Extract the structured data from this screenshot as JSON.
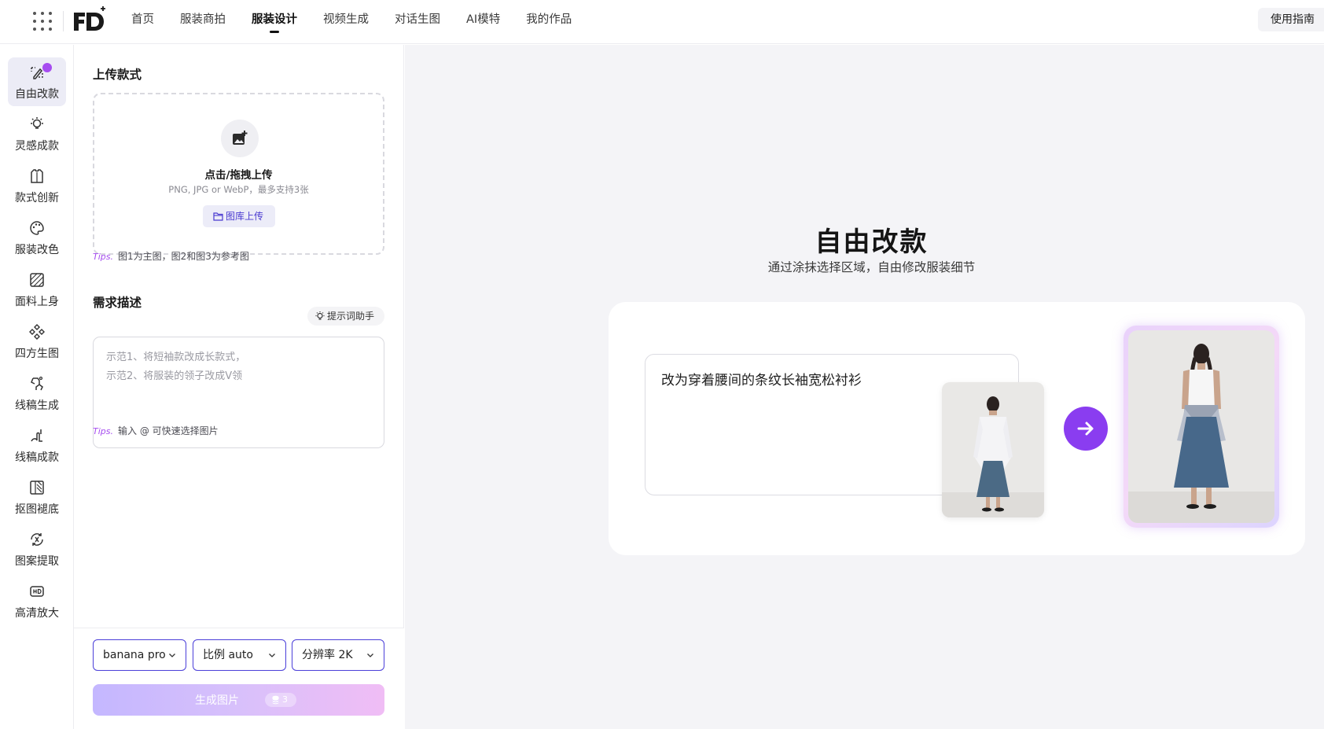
{
  "topbar": {
    "menu_icon": "grid-dots-icon",
    "logo_text": "FD",
    "nav": [
      {
        "label": "首页",
        "active": false
      },
      {
        "label": "服装商拍",
        "active": false
      },
      {
        "label": "服装设计",
        "active": true
      },
      {
        "label": "视频生成",
        "active": false
      },
      {
        "label": "对话生图",
        "active": false
      },
      {
        "label": "AI模特",
        "active": false
      },
      {
        "label": "我的作品",
        "active": false
      }
    ],
    "guide_label": "使用指南"
  },
  "rail": [
    {
      "label": "自由改款",
      "icon": "magic-brush-icon",
      "active": true
    },
    {
      "label": "灵感成款",
      "icon": "lightbulb-icon",
      "active": false
    },
    {
      "label": "款式创新",
      "icon": "shirt-icon",
      "active": false
    },
    {
      "label": "服装改色",
      "icon": "palette-icon",
      "active": false
    },
    {
      "label": "面料上身",
      "icon": "fabric-icon",
      "active": false
    },
    {
      "label": "四方生图",
      "icon": "diamond-grid-icon",
      "active": false
    },
    {
      "label": "线稿生成",
      "icon": "sketch-icon",
      "active": false
    },
    {
      "label": "线稿成款",
      "icon": "line-art-icon",
      "active": false
    },
    {
      "label": "抠图褪底",
      "icon": "cutout-icon",
      "active": false
    },
    {
      "label": "图案提取",
      "icon": "pattern-icon",
      "active": false
    },
    {
      "label": "高清放大",
      "icon": "hd-icon",
      "active": false
    }
  ],
  "panel": {
    "upload_title": "上传款式",
    "upload_main": "点击/拖拽上传",
    "upload_sub": "PNG, JPG or WebP，最多支持3张",
    "gallery_label": "图库上传",
    "tips_tag": "Tips.",
    "upload_tip": "图1为主图，图2和图3为参考图",
    "desc_title": "需求描述",
    "helper_label": "提示词助手",
    "desc_placeholder": "示范1、将短袖款改成长款式，\n示范2、将服装的领子改成V领",
    "desc_tip": "输入 @ 可快速选择图片",
    "model_select": "banana pro",
    "ratio_select": "比例 auto",
    "resolution_select": "分辨率 2K",
    "generate_label": "生成图片",
    "generate_cost": "3"
  },
  "main": {
    "title": "自由改款",
    "subtitle": "通过涂抹选择区域，自由修改服装细节",
    "example_prompt": "改为穿着腰间的条纹长袖宽松衬衫"
  },
  "colors": {
    "accent": "#8a3df0",
    "select_border": "#4b3fd9",
    "canvas_bg": "#f4f4f7"
  }
}
